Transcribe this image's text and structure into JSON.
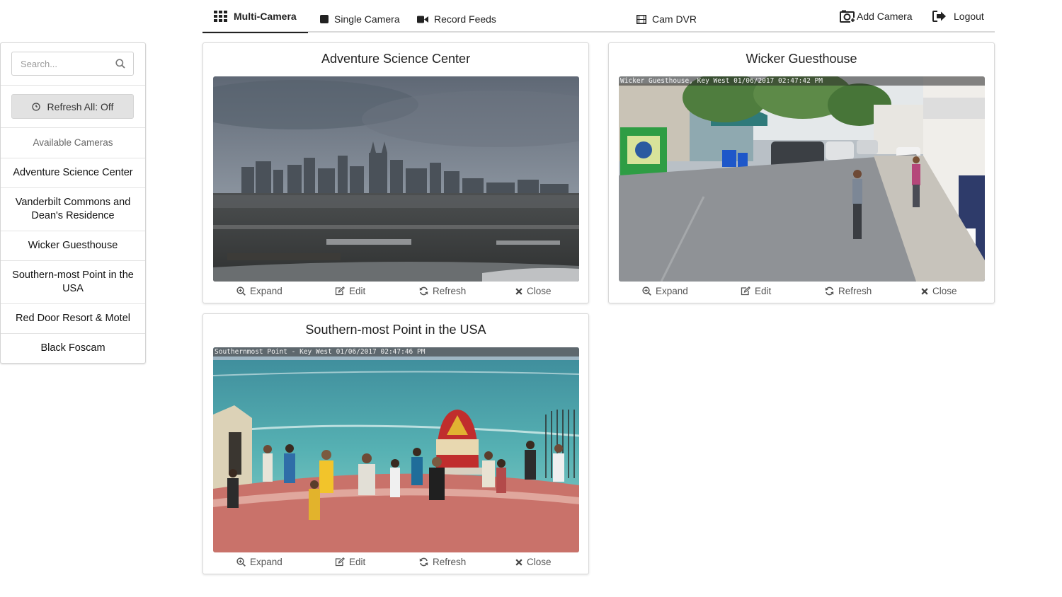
{
  "nav": {
    "multi_camera": "Multi-Camera",
    "single_camera": "Single Camera",
    "record_feeds": "Record Feeds",
    "cam_dvr": "Cam DVR",
    "add_camera": "Add Camera",
    "logout": "Logout"
  },
  "sidebar": {
    "search_placeholder": "Search...",
    "refresh_all": "Refresh All: Off",
    "available_label": "Available Cameras",
    "cameras": [
      "Adventure Science Center",
      "Vanderbilt Commons and Dean's Residence",
      "Wicker Guesthouse",
      "Southern-most Point in the USA",
      "Red Door Resort & Motel",
      "Black Foscam"
    ]
  },
  "cards": [
    {
      "title": "Adventure Science Center",
      "stamp": ""
    },
    {
      "title": "Wicker Guesthouse",
      "stamp": "Wicker Guesthouse, Key West 01/06/2017 02:47:42 PM"
    },
    {
      "title": "Southern-most Point in the USA",
      "stamp": "Southernmost Point - Key West 01/06/2017 02:47:46 PM"
    }
  ],
  "actions": {
    "expand": "Expand",
    "edit": "Edit",
    "refresh": "Refresh",
    "close": "Close"
  },
  "colors": {
    "active_underline": "#222222",
    "button_gray": "#e2e2e2",
    "border": "#d8d8d8"
  }
}
